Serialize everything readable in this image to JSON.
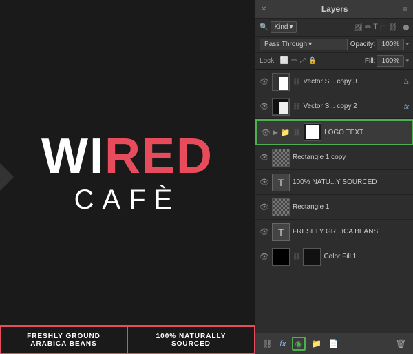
{
  "canvas": {
    "logo": {
      "wi": "WI",
      "red": "RED",
      "cafe": "CAFÈ"
    },
    "bottom_bar": [
      {
        "line1": "FRESHLY GROUND",
        "line2": "ARABICA BEANS"
      },
      {
        "line1": "100% NATURALLY",
        "line2": "SOURCED"
      }
    ]
  },
  "layers_panel": {
    "title": "Layers",
    "close_label": "✕",
    "menu_label": "≡",
    "filter": {
      "kind_label": "Kind",
      "icons": [
        "🖼",
        "✏",
        "T",
        "📐",
        "🔗"
      ],
      "dot": true
    },
    "blend": {
      "mode_label": "Pass Through",
      "opacity_label": "Opacity:",
      "opacity_value": "100%"
    },
    "lock": {
      "label": "Lock:",
      "icons": [
        "⬜",
        "✏",
        "⤢",
        "🔒"
      ],
      "fill_label": "Fill:",
      "fill_value": "100%"
    },
    "layers": [
      {
        "id": "layer-vector-copy3",
        "visible": true,
        "name": "Vector S... copy 3",
        "has_fx": true,
        "has_chain": true,
        "thumb_type": "vector_white"
      },
      {
        "id": "layer-vector-copy2",
        "visible": true,
        "name": "Vector S... copy 2",
        "has_fx": true,
        "has_chain": true,
        "thumb_type": "vector_black"
      },
      {
        "id": "layer-logo-text",
        "visible": true,
        "name": "LOGO TEXT",
        "selected": true,
        "has_chain": true,
        "thumb_type": "logo",
        "has_arrow": true,
        "has_folder": true
      },
      {
        "id": "layer-rect-copy",
        "visible": true,
        "name": "Rectangle 1 copy",
        "thumb_type": "rect_checker"
      },
      {
        "id": "layer-100nat",
        "visible": true,
        "name": "100% NATU...Y SOURCED",
        "thumb_type": "text",
        "text_char": "T"
      },
      {
        "id": "layer-rect1",
        "visible": true,
        "name": "Rectangle 1",
        "thumb_type": "rect_checker"
      },
      {
        "id": "layer-freshly",
        "visible": true,
        "name": "FRESHLY GR...ICA BEANS",
        "thumb_type": "text",
        "text_char": "T"
      },
      {
        "id": "layer-color-fill",
        "visible": true,
        "name": "Color Fill 1",
        "has_chain": true,
        "thumb_type": "color_fill"
      }
    ],
    "toolbar": {
      "link_label": "⛓",
      "fx_label": "fx",
      "layer_style_label": "◉",
      "new_group_label": "📁",
      "new_layer_label": "📄",
      "delete_label": "🗑"
    }
  }
}
